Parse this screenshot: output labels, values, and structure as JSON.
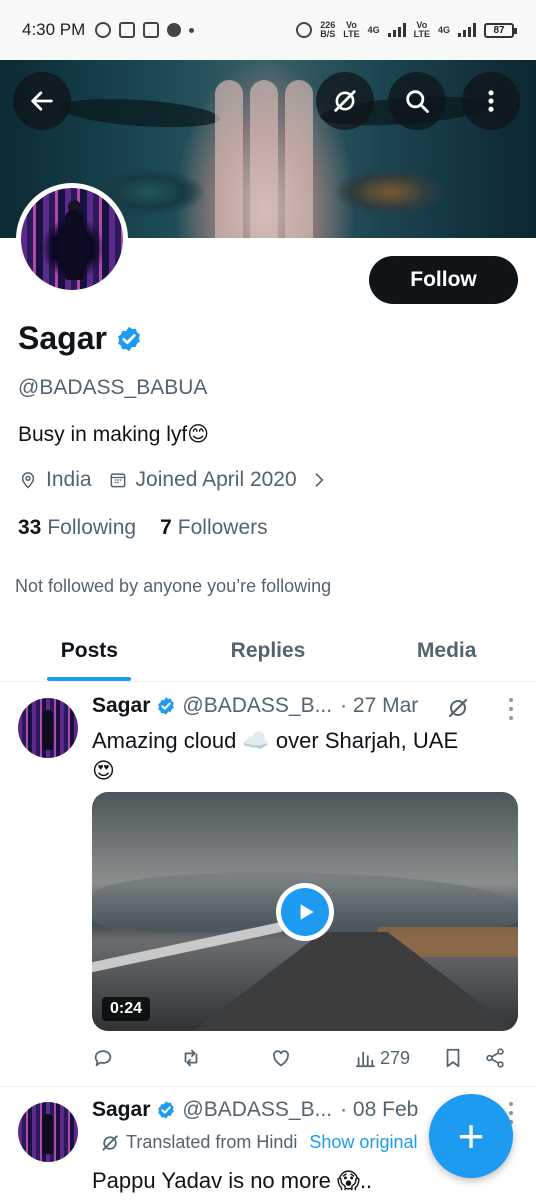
{
  "status_bar": {
    "time": "4:30 PM",
    "net_speed": "226",
    "net_unit": "B/S",
    "vo1": "Vo",
    "lte1": "LTE",
    "net1": "4G",
    "vo2": "Vo",
    "lte2": "LTE",
    "net2": "4G",
    "battery": "87"
  },
  "header": {
    "back_icon": "arrow-left-icon",
    "grok_icon": "grok-icon",
    "search_icon": "search-icon",
    "more_icon": "more-vertical-icon"
  },
  "profile": {
    "name": "Sagar",
    "handle": "@BADASS_BABUA",
    "bio": "Busy in making lyf😊",
    "location": "India",
    "joined": "Joined April 2020",
    "following_count": "33",
    "following_label": "Following",
    "followers_count": "7",
    "followers_label": "Followers",
    "not_followed": "Not followed by anyone you’re following",
    "follow_label": "Follow"
  },
  "tabs": [
    {
      "label": "Posts",
      "active": true
    },
    {
      "label": "Replies",
      "active": false
    },
    {
      "label": "Media",
      "active": false
    }
  ],
  "posts": [
    {
      "name": "Sagar",
      "handle": "@BADASS_B...",
      "date": "· 27 Mar",
      "text_line1": "Amazing cloud ☁️ over Sharjah, UAE",
      "text_line2": "😍",
      "video_duration": "0:24",
      "views": "279"
    },
    {
      "name": "Sagar",
      "handle": "@BADASS_B...",
      "date": "· 08 Feb",
      "translated": "Translated from Hindi",
      "show_original": "Show original",
      "text": "Pappu Yadav is no more 😱.."
    }
  ],
  "fab": {
    "label": "+",
    "icon": "compose-plus-icon"
  },
  "colors": {
    "accent": "#1d9bf0",
    "text": "#0f1419",
    "secondary": "#536471"
  }
}
